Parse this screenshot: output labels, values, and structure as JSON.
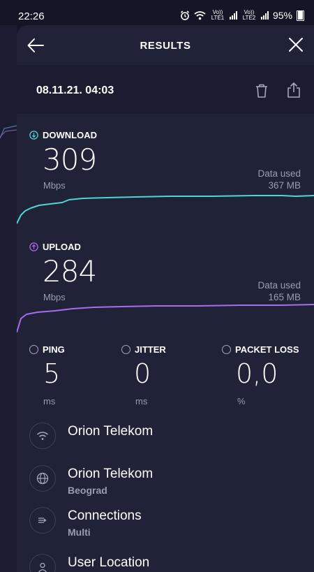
{
  "status": {
    "time": "22:26",
    "sim1": "Vo)) LTE1",
    "sim2": "Vo)) LTE2",
    "battery": "95%"
  },
  "header": {
    "title": "RESULTS"
  },
  "result": {
    "date": "08.11.21. 04:03"
  },
  "download": {
    "label": "DOWNLOAD",
    "value": "309",
    "unit": "Mbps",
    "data_used_label": "Data used",
    "data_used_value": "367 MB",
    "color": "#4fd6d6"
  },
  "upload": {
    "label": "UPLOAD",
    "value": "284",
    "unit": "Mbps",
    "data_used_label": "Data used",
    "data_used_value": "165 MB",
    "color": "#a96bf0"
  },
  "ping": {
    "label": "PING",
    "value": "5",
    "unit": "ms"
  },
  "jitter": {
    "label": "JITTER",
    "value": "0",
    "unit": "ms"
  },
  "packet_loss": {
    "label": "PACKET LOSS",
    "value": "0,0",
    "unit": "%"
  },
  "details": [
    {
      "icon": "wifi-icon",
      "title": "Orion Telekom",
      "sub": ""
    },
    {
      "icon": "globe-icon",
      "title": "Orion Telekom",
      "sub": "Beograd"
    },
    {
      "icon": "connections-icon",
      "title": "Connections",
      "sub": "Multi"
    },
    {
      "icon": "user-icon",
      "title": "User Location",
      "sub": ""
    }
  ]
}
